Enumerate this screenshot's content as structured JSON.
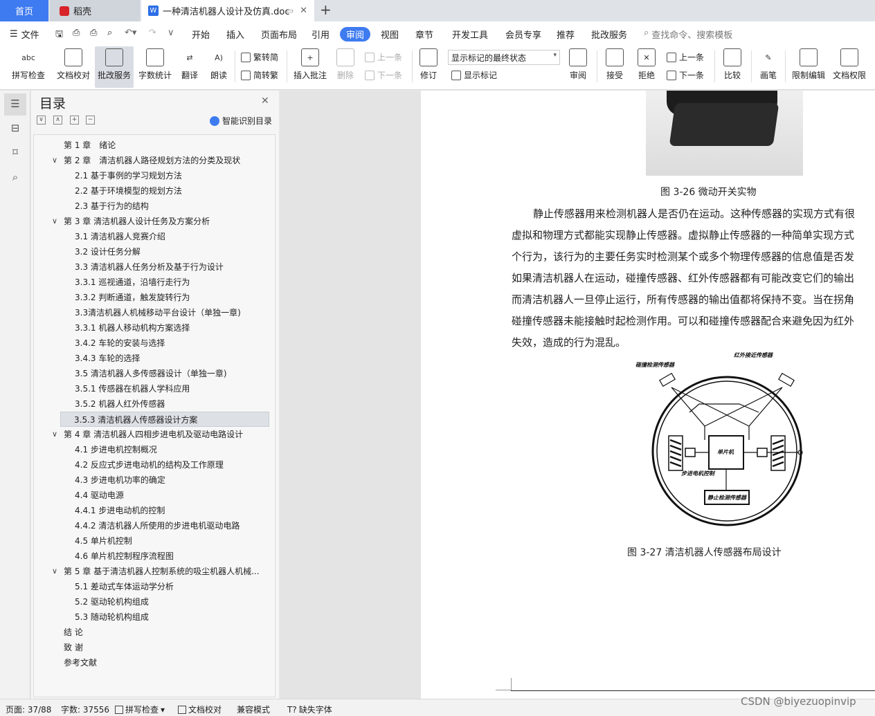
{
  "tabs": {
    "home": "首页",
    "daoke": "稻壳",
    "doc": "一种清洁机器人设计及仿真.doc"
  },
  "menu": {
    "file": "文件",
    "items": [
      "开始",
      "插入",
      "页面布局",
      "引用",
      "审阅",
      "视图",
      "章节",
      "开发工具",
      "会员专享",
      "推荐",
      "批改服务"
    ],
    "search": "查找命令、搜索模板"
  },
  "toolbar": {
    "spell": "拼写检查",
    "proof": "文档校对",
    "review_service": "批改服务",
    "wordcount": "字数统计",
    "translate": "翻译",
    "read": "朗读",
    "trad": "繁转简",
    "simp": "简转繁",
    "insert_comment": "插入批注",
    "delete": "删除",
    "prev": "上一条",
    "next": "下一条",
    "revise": "修订",
    "markup_state": "显示标记的最终状态",
    "show_markup": "显示标记",
    "review": "审阅",
    "accept": "接受",
    "reject": "拒绝",
    "prev2": "上一条",
    "next2": "下一条",
    "compare": "比较",
    "pen": "画笔",
    "restrict": "限制编辑",
    "perm": "文档权限"
  },
  "toc": {
    "title": "目录",
    "smart": "智能识别目录",
    "items": [
      {
        "text": "第 1 章　绪论",
        "level": 0,
        "chev": false
      },
      {
        "text": "第 2 章　清洁机器人路径规划方法的分类及现状",
        "level": 0,
        "chev": true
      },
      {
        "text": "2.1 基于事例的学习规划方法",
        "level": 1,
        "chev": false
      },
      {
        "text": "2.2 基于环境模型的规划方法",
        "level": 1,
        "chev": false
      },
      {
        "text": "2.3 基于行为的结构",
        "level": 1,
        "chev": false
      },
      {
        "text": "第 3 章 清洁机器人设计任务及方案分析",
        "level": 0,
        "chev": true
      },
      {
        "text": "3.1 清洁机器人竞赛介绍",
        "level": 1,
        "chev": false
      },
      {
        "text": "3.2 设计任务分解",
        "level": 1,
        "chev": false
      },
      {
        "text": "3.3 清洁机器人任务分析及基于行为设计",
        "level": 1,
        "chev": false
      },
      {
        "text": "3.3.1 巡视通道，沿墙行走行为",
        "level": 1,
        "chev": false
      },
      {
        "text": "3.3.2 判断通道，触发旋转行为",
        "level": 1,
        "chev": false
      },
      {
        "text": "3.3清洁机器人机械移动平台设计（单独一章)",
        "level": 1,
        "chev": false
      },
      {
        "text": "3.3.1 机器人移动机构方案选择",
        "level": 1,
        "chev": false
      },
      {
        "text": "3.4.2 车轮的安装与选择",
        "level": 1,
        "chev": false
      },
      {
        "text": "3.4.3 车轮的选择",
        "level": 1,
        "chev": false
      },
      {
        "text": "3.5 清洁机器人多传感器设计（单独一章)",
        "level": 1,
        "chev": false
      },
      {
        "text": "3.5.1 传感器在机器人学科应用",
        "level": 1,
        "chev": false
      },
      {
        "text": "3.5.2 机器人红外传感器",
        "level": 1,
        "chev": false
      },
      {
        "text": "3.5.3 清洁机器人传感器设计方案",
        "level": 1,
        "chev": false,
        "highlight": true
      },
      {
        "text": "第 4 章 清洁机器人四相步进电机及驱动电路设计",
        "level": 0,
        "chev": true
      },
      {
        "text": "4.1 步进电机控制概况",
        "level": 1,
        "chev": false
      },
      {
        "text": "4.2 反应式步进电动机的结构及工作原理",
        "level": 1,
        "chev": false
      },
      {
        "text": "4.3 步进电机功率的确定",
        "level": 1,
        "chev": false
      },
      {
        "text": "4.4 驱动电源",
        "level": 1,
        "chev": false
      },
      {
        "text": "4.4.1 步进电动机的控制",
        "level": 1,
        "chev": false
      },
      {
        "text": "4.4.2 清洁机器人所使用的步进电机驱动电路",
        "level": 1,
        "chev": false
      },
      {
        "text": "4.5 单片机控制",
        "level": 1,
        "chev": false
      },
      {
        "text": "4.6 单片机控制程序流程图",
        "level": 1,
        "chev": false
      },
      {
        "text": "第 5 章 基于清洁机器人控制系统的吸尘机器人机械...",
        "level": 0,
        "chev": true
      },
      {
        "text": "5.1 差动式车体运动学分析",
        "level": 1,
        "chev": false
      },
      {
        "text": "5.2 驱动轮机构组成",
        "level": 1,
        "chev": false
      },
      {
        "text": "5.3 随动轮机构组成",
        "level": 1,
        "chev": false
      },
      {
        "text": "结 论",
        "level": 0,
        "chev": false
      },
      {
        "text": "致 谢",
        "level": 0,
        "chev": false
      },
      {
        "text": "参考文献",
        "level": 0,
        "chev": false
      }
    ]
  },
  "document": {
    "fig26_caption": "图 3-26 微动开关实物",
    "lines": [
      "静止传感器用来检测机器人是否仍在运动。这种传感器的实现方式有很",
      "虚拟和物理方式都能实现静止传感器。虚拟静止传感器的一种简单实现方式",
      "个行为，该行为的主要任务实时检测某个或多个物理传感器的信息值是否发",
      "如果清洁机器人在运动，碰撞传感器、红外传感器都有可能改变它们的输出",
      "而清洁机器人一旦停止运行，所有传感器的输出值都将保持不变。当在拐角",
      "碰撞传感器未能接触时起检测作用。可以和碰撞传感器配合来避免因为红外",
      "失效，造成的行为混乱。"
    ],
    "fig27": {
      "label_bump": "碰撞检测传感器",
      "label_ir": "红外接近传感器",
      "label_mcu": "单片机",
      "label_motor": "步进电机控制",
      "label_static": "静止检测传感器"
    },
    "fig27_caption": "图 3-27 清洁机器人传感器布局设计"
  },
  "status": {
    "page": "页面: 37/88",
    "words": "字数: 37556",
    "spell": "拼写检查",
    "proof": "文档校对",
    "compat": "兼容模式",
    "font": "缺失字体"
  },
  "watermark": "CSDN @biyezuopinvip"
}
